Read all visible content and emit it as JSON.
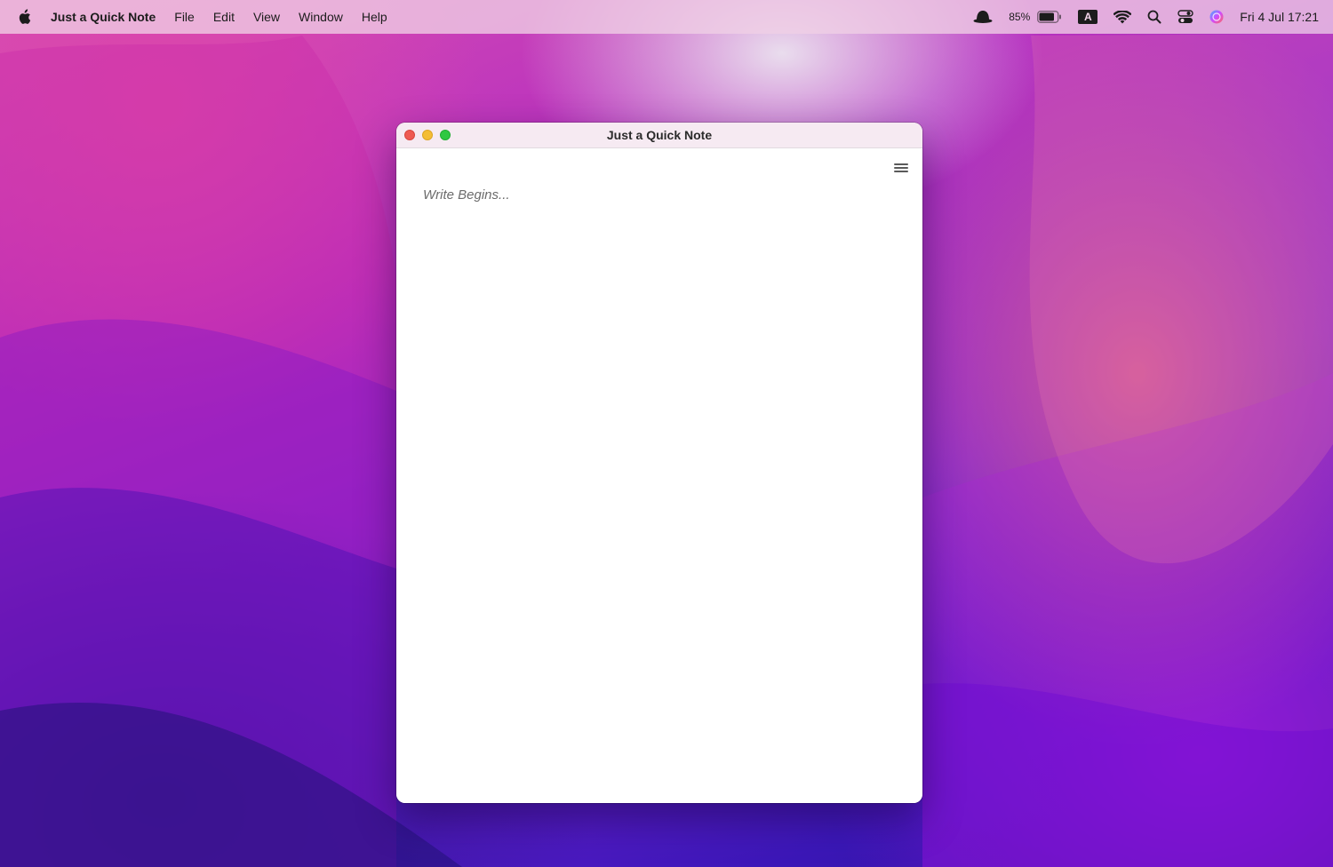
{
  "menubar": {
    "app_name": "Just a Quick Note",
    "menus": [
      "File",
      "Edit",
      "View",
      "Window",
      "Help"
    ],
    "battery_percent": "85%",
    "keyboard_indicator": "A",
    "clock": "Fri 4 Jul  17:21",
    "icons": [
      "apple-icon",
      "hat-icon",
      "battery-icon",
      "keyboard-input-icon",
      "wifi-icon",
      "search-icon",
      "control-center-icon",
      "siri-icon"
    ]
  },
  "window": {
    "title": "Just a Quick Note",
    "menu_icon": "hamburger-menu-icon",
    "note": {
      "value": "",
      "placeholder": "Write Begins..."
    }
  },
  "colors": {
    "close": "#ee5a52",
    "minimize": "#f4bd35",
    "maximize": "#2fc841"
  }
}
